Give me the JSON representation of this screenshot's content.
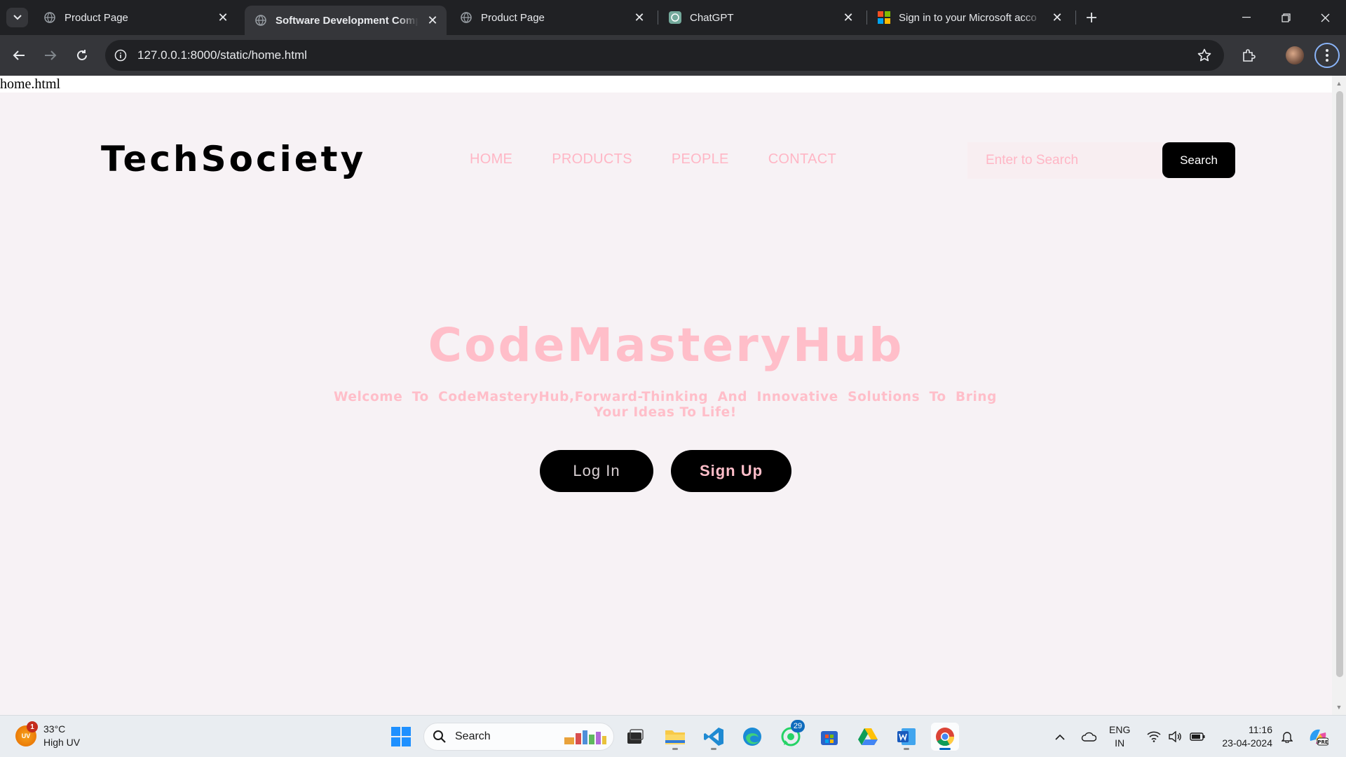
{
  "browser": {
    "tabs": [
      {
        "title": "Product Page",
        "active": false
      },
      {
        "title": "Software Development Compa",
        "active": true
      },
      {
        "title": "Product Page",
        "active": false
      },
      {
        "title": "ChatGPT",
        "active": false
      },
      {
        "title": "Sign in to your Microsoft acco",
        "active": false
      }
    ],
    "url": "127.0.0.1:8000/static/home.html"
  },
  "page": {
    "file_label": "home.html",
    "logo": "TechSociety",
    "nav": [
      "HOME",
      "PRODUCTS",
      "PEOPLE",
      "CONTACT"
    ],
    "search": {
      "placeholder": "Enter to Search",
      "button": "Search"
    },
    "hero": {
      "title": "CodeMasteryHub",
      "subtitle": "Welcome To CodeMasteryHub,Forward-Thinking And Innovative Solutions To Bring Your Ideas To Life!",
      "login_label": "Log In",
      "signup_label": "Sign Up"
    },
    "colors": {
      "accent_pink": "#ffbec9",
      "button_black": "#000000",
      "background": "#f7f2f5"
    }
  },
  "taskbar": {
    "weather": {
      "temp": "33°C",
      "desc": "High UV",
      "badge": "1",
      "icon_text": "UV"
    },
    "search_label": "Search",
    "whatsapp_badge": "29",
    "language": {
      "line1": "ENG",
      "line2": "IN"
    },
    "clock": {
      "time": "11:16",
      "date": "23-04-2024"
    }
  }
}
